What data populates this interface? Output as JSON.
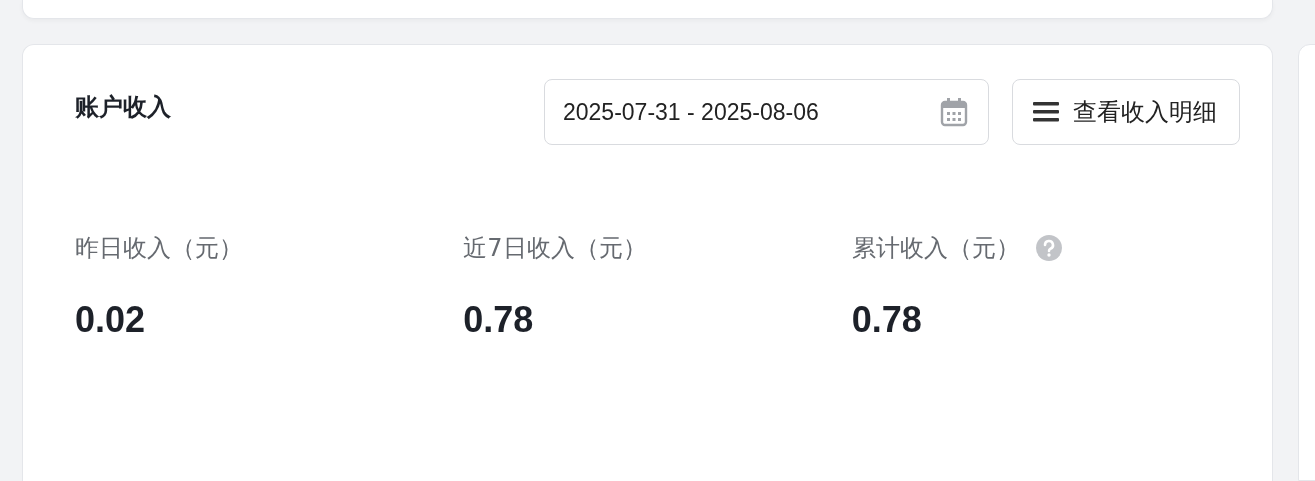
{
  "card": {
    "title": "账户收入",
    "date_range": {
      "value": "2025-07-31 - 2025-08-06"
    },
    "detail_button": {
      "label": "查看收入明细"
    },
    "stats": [
      {
        "label": "昨日收入（元）",
        "value": "0.02",
        "help": false
      },
      {
        "label": "近7日收入（元）",
        "value": "0.78",
        "help": false
      },
      {
        "label": "累计收入（元）",
        "value": "0.78",
        "help": true
      }
    ]
  }
}
